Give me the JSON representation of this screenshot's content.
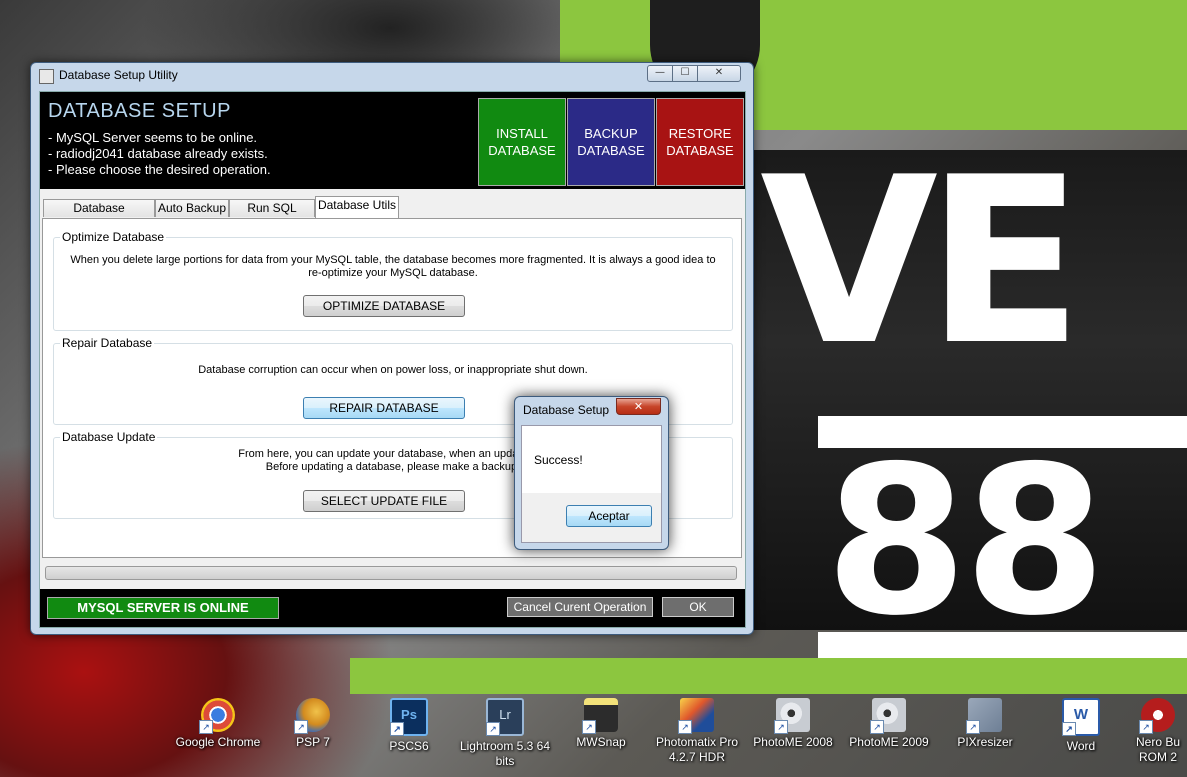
{
  "wallpaper": {
    "big_letters": "VE",
    "big_digits": "88"
  },
  "desktop_icons": [
    {
      "label": "Google Chrome",
      "icon": "chrome-icon",
      "color": "#dd4b39"
    },
    {
      "label": "PSP 7",
      "icon": "psp-icon",
      "color": "#d38b1f"
    },
    {
      "label": "PSCS6",
      "icon": "photoshop-icon",
      "color": "#0b2f5e"
    },
    {
      "label": "Lightroom 5.3 64 bits",
      "icon": "lightroom-icon",
      "color": "#2a3f5a"
    },
    {
      "label": "MWSnap",
      "icon": "camera-icon",
      "color": "#2c2c2c"
    },
    {
      "label": "Photomatix Pro 4.2.7 HDR",
      "icon": "photomatix-icon",
      "color": "#1f4d9a"
    },
    {
      "label": "PhotoME 2008",
      "icon": "photome-icon",
      "color": "#c8ccd2"
    },
    {
      "label": "PhotoME 2009",
      "icon": "photome-icon",
      "color": "#c8ccd2"
    },
    {
      "label": "PIXresizer",
      "icon": "pixresizer-icon",
      "color": "#6e7f95"
    },
    {
      "label": "Word",
      "icon": "word-icon",
      "color": "#2a5aa8"
    },
    {
      "label": "Nero Bu ROM 2",
      "icon": "nero-icon",
      "color": "#b51d1d"
    }
  ],
  "window": {
    "title": "Database Setup Utility",
    "controls": {
      "minimize": "—",
      "maximize": "☐",
      "close": "✕"
    },
    "header": {
      "title": "DATABASE SETUP",
      "messages": [
        "- MySQL Server seems to be online.",
        "- radiodj2041 database already exists.",
        "- Please choose the desired operation."
      ],
      "buttons": {
        "install": "INSTALL\nDATABASE",
        "backup": "BACKUP\nDATABASE",
        "restore": "RESTORE\nDATABASE"
      }
    },
    "tabs": [
      "Database Installation",
      "Auto Backup",
      "Run SQL Query",
      "Database Utils"
    ],
    "active_tab": "Database Utils",
    "groups": {
      "optimize": {
        "legend": "Optimize Database",
        "desc_line1": "When you delete large portions for data from your MySQL table, the database becomes more fragmented. It is always a good idea to",
        "desc_line2": "re-optimize your MySQL database.",
        "button": "OPTIMIZE DATABASE"
      },
      "repair": {
        "legend": "Repair Database",
        "desc_line1": "Database corruption can occur when on power loss, or inappropriate shut down.",
        "button": "REPAIR DATABASE"
      },
      "update": {
        "legend": "Database Update",
        "desc_line1": "From here, you can update your database, when an update is a",
        "desc_line2": "Before updating a database, please make a backup!",
        "button": "SELECT UPDATE FILE"
      }
    },
    "footer": {
      "status": "MYSQL SERVER IS ONLINE",
      "cancel": "Cancel Curent Operation",
      "ok": "OK"
    }
  },
  "dialog": {
    "title": "Database Setup",
    "close": "✕",
    "message": "Success!",
    "button": "Aceptar"
  },
  "colors": {
    "install": "#118a11",
    "backup": "#2b2a87",
    "restore": "#a81313",
    "status_online": "#118a11",
    "wallpaper_green": "#8cc63f"
  }
}
